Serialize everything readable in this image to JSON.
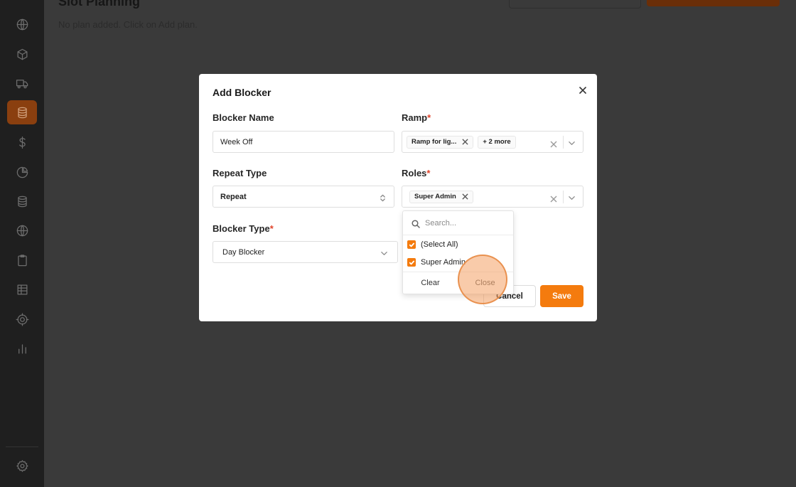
{
  "page": {
    "title": "Slot Planning",
    "empty_message": "No plan added. Click on Add plan."
  },
  "sidebar": {
    "items": [
      {
        "icon": "globe-icon"
      },
      {
        "icon": "box-icon"
      },
      {
        "icon": "truck-icon"
      },
      {
        "icon": "database-icon",
        "active": true
      },
      {
        "icon": "dollar-icon"
      },
      {
        "icon": "pie-chart-icon"
      },
      {
        "icon": "database-icon"
      },
      {
        "icon": "globe-icon"
      },
      {
        "icon": "clipboard-icon"
      },
      {
        "icon": "table-icon"
      },
      {
        "icon": "target-icon"
      },
      {
        "icon": "bar-chart-icon"
      }
    ],
    "footer_icon": "settings-icon"
  },
  "modal": {
    "title": "Add Blocker",
    "blocker_name": {
      "label": "Blocker Name",
      "value": "Week Off"
    },
    "ramp": {
      "label": "Ramp",
      "required_mark": "*",
      "chip": "Ramp for lig...",
      "more": "+ 2 more"
    },
    "repeat_type": {
      "label": "Repeat Type",
      "value": "Repeat"
    },
    "roles": {
      "label": "Roles",
      "required_mark": "*",
      "chip": "Super Admin"
    },
    "blocker_type": {
      "label": "Blocker Type",
      "required_mark": "*",
      "value": "Day Blocker"
    },
    "cancel_label": "Cancel",
    "save_label": "Save"
  },
  "dropdown": {
    "search_placeholder": "Search...",
    "options": [
      {
        "label": "(Select All)",
        "checked": true
      },
      {
        "label": "Super Admin",
        "checked": true
      }
    ],
    "clear_label": "Clear",
    "close_label": "Close"
  },
  "colors": {
    "accent": "#f47b0e",
    "required": "#e0442b",
    "overlay": "#3a3a3a",
    "sidebar": "#1f1f1f"
  }
}
